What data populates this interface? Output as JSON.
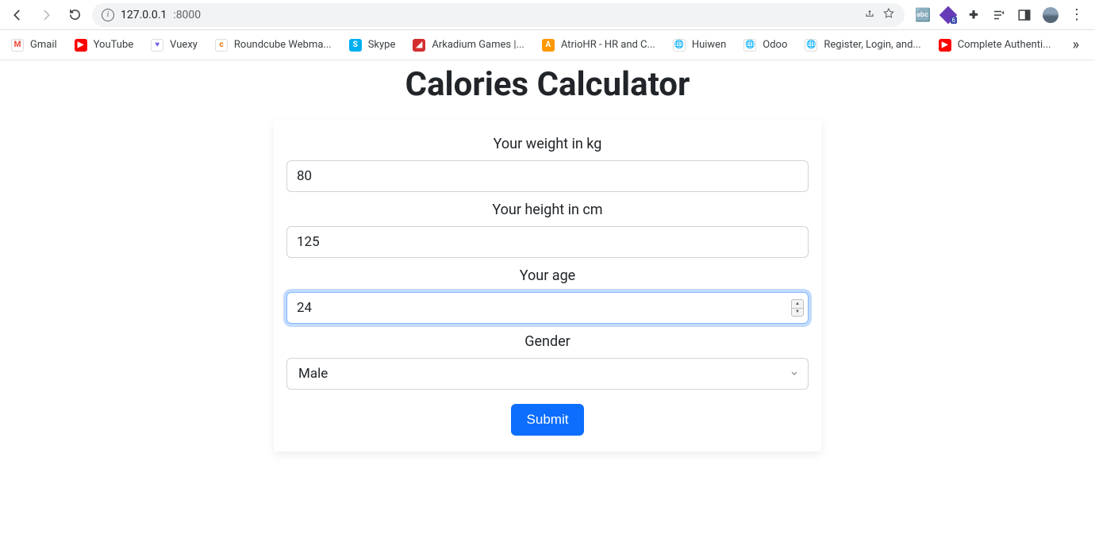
{
  "browser": {
    "url_host": "127.0.0.1",
    "url_port": ":8000"
  },
  "bookmarks": [
    {
      "label": "Gmail",
      "bg": "#ffffff",
      "fg": "#ea4335",
      "initial": "M"
    },
    {
      "label": "YouTube",
      "bg": "#ff0000",
      "fg": "#ffffff",
      "initial": "▶"
    },
    {
      "label": "Vuexy",
      "bg": "#ffffff",
      "fg": "#7367f0",
      "initial": "♥"
    },
    {
      "label": "Roundcube Webma...",
      "bg": "#ffffff",
      "fg": "#ef6c00",
      "initial": "c"
    },
    {
      "label": "Skype",
      "bg": "#00aff0",
      "fg": "#ffffff",
      "initial": "S"
    },
    {
      "label": "Arkadium Games |...",
      "bg": "#d32f2f",
      "fg": "#ffffff",
      "initial": "◢"
    },
    {
      "label": "AtrioHR - HR and C...",
      "bg": "#ff9800",
      "fg": "#ffffff",
      "initial": "A"
    },
    {
      "label": "Huiwen",
      "bg": "#ffffff",
      "fg": "#000000",
      "initial": "🌐"
    },
    {
      "label": "Odoo",
      "bg": "#ffffff",
      "fg": "#000000",
      "initial": "🌐"
    },
    {
      "label": "Register, Login, and...",
      "bg": "#ffffff",
      "fg": "#000000",
      "initial": "🌐"
    },
    {
      "label": "Complete Authenti...",
      "bg": "#ff0000",
      "fg": "#ffffff",
      "initial": "▶"
    }
  ],
  "page": {
    "title": "Calories Calculator",
    "fields": {
      "weight": {
        "label": "Your weight in kg",
        "value": "80"
      },
      "height": {
        "label": "Your height in cm",
        "value": "125"
      },
      "age": {
        "label": "Your age",
        "value": "24",
        "focused": true
      },
      "gender": {
        "label": "Gender",
        "value": "Male"
      }
    },
    "submit": "Submit"
  }
}
